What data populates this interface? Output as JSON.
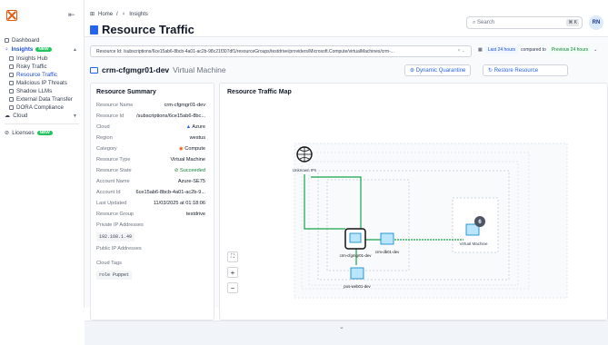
{
  "sidebar": {
    "items": [
      {
        "label": "Dashboard"
      },
      {
        "label": "Insights",
        "badge": "NEW"
      },
      {
        "label": "Insights Hub"
      },
      {
        "label": "Risky Traffic"
      },
      {
        "label": "Resource Traffic"
      },
      {
        "label": "Malicious IP Threats"
      },
      {
        "label": "Shadow LLMs"
      },
      {
        "label": "External Data Transfer"
      },
      {
        "label": "DORA Compliance"
      },
      {
        "label": "Cloud"
      },
      {
        "label": "Licenses",
        "badge": "NEW"
      }
    ]
  },
  "header": {
    "crumb_home": "Home",
    "crumb_sep": "/",
    "crumb_section": "Insights",
    "title": "Resource Traffic"
  },
  "search": {
    "placeholder": "Search",
    "shortcut": "⌘ K"
  },
  "user": {
    "initials": "RN"
  },
  "filter": {
    "text": "Resource Id: /subscriptions/6ce15ab6-8bcb-4a01-ac2b-98c21f307df1/resourceGroups/testdrive/providers/Microsoft.Compute/virtualMachines/crm-..."
  },
  "time": {
    "range": "Last 24 hours",
    "compared": "compared to",
    "previous": "Previous 24 hours"
  },
  "resource": {
    "name": "crm-cfgmgr01-dev",
    "type": "Virtual Machine"
  },
  "actions": {
    "quarantine": "Dynamic Quarantine",
    "restore": "Restore Resource"
  },
  "summary": {
    "title": "Resource Summary",
    "rows": [
      {
        "k": "Resource Name",
        "v": "crm-cfgmgr01-dev"
      },
      {
        "k": "Resource Id",
        "v": "/subscriptions/6ce15ab6-8bc..."
      },
      {
        "k": "Cloud",
        "v": "Azure"
      },
      {
        "k": "Region",
        "v": "westus"
      },
      {
        "k": "Category",
        "v": "Compute"
      },
      {
        "k": "Resource Type",
        "v": "Virtual Machine"
      },
      {
        "k": "Resource State",
        "v": "Succeeded"
      },
      {
        "k": "Account Name",
        "v": "Azure-SE75"
      },
      {
        "k": "Account Id",
        "v": "6ce15ab6-8bcb-4a01-ac2b-9..."
      },
      {
        "k": "Last Updated",
        "v": "11/03/2025 at 01:18:06"
      },
      {
        "k": "Resource Group",
        "v": "testdrive"
      }
    ],
    "private_ip_label": "Private IP Addresses",
    "private_ip": "192.168.1.49",
    "public_ip_label": "Public IP Addresses",
    "tags_label": "Cloud Tags",
    "tag_key": "role",
    "tag_val": "Puppet"
  },
  "map": {
    "title": "Resource Traffic Map",
    "unknown": "Unknown IPs",
    "node1": "crm-cfgmgr01-dev",
    "node2": "crm-db01-dev",
    "node3": "pos-web01-dev",
    "vm": "Virtual Machine",
    "vm_count": "6",
    "zoom_in": "+",
    "zoom_out": "−"
  }
}
